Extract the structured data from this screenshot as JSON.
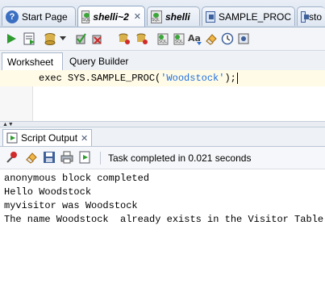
{
  "tabs": [
    {
      "label": "Start Page",
      "icon": "help-icon"
    },
    {
      "label": "shelli~2",
      "icon": "sql-worksheet-icon",
      "active": true
    },
    {
      "label": "shelli",
      "icon": "sql-worksheet-icon"
    },
    {
      "label": "SAMPLE_PROC",
      "icon": "procedure-icon"
    },
    {
      "label": "sto",
      "icon": "procedure-icon"
    }
  ],
  "editor_tabs": {
    "worksheet": "Worksheet",
    "query_builder": "Query Builder"
  },
  "editor": {
    "code_prefix": "exec SYS.SAMPLE_PROC(",
    "code_string": "'Woodstock'",
    "code_suffix": ");"
  },
  "output_panel": {
    "tab_label": "Script Output",
    "status": "Task completed in 0.021 seconds",
    "lines": [
      "anonymous block completed",
      "Hello Woodstock",
      "myvisitor was Woodstock",
      "The name Woodstock  already exists in the Visitor Table"
    ]
  }
}
